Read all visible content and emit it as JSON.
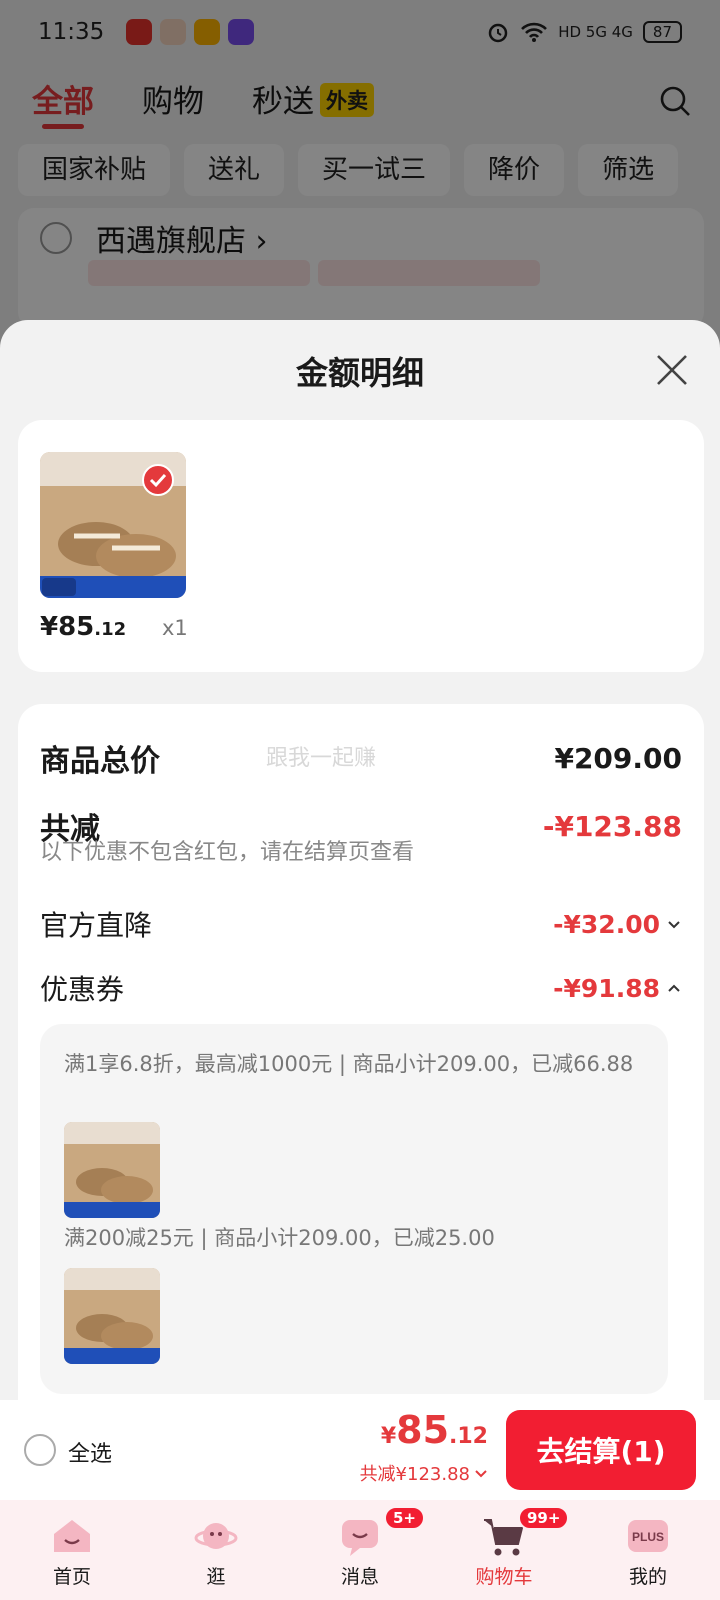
{
  "status_bar": {
    "time": "11:35",
    "network": "HD 5G 4G",
    "battery": "87"
  },
  "top_tabs": [
    {
      "label": "全部",
      "active": true
    },
    {
      "label": "购物",
      "active": false
    },
    {
      "label": "秒送",
      "active": false,
      "badge": "外卖"
    }
  ],
  "filter_chips": [
    "国家补贴",
    "送礼",
    "买一试三",
    "降价",
    "筛选"
  ],
  "shop": {
    "name": "西遇旗舰店 ›"
  },
  "sheet": {
    "title": "金额明细",
    "product": {
      "price_int": "¥85",
      "price_dec": ".12",
      "qty": "x1"
    },
    "watermark": "跟我一起赚",
    "total_label": "商品总价",
    "total_value": "¥209.00",
    "discount_label": "共减",
    "discount_value": "-¥123.88",
    "discount_note": "以下优惠不包含红包，请在结算页查看",
    "official_label": "官方直降",
    "official_value": "-¥32.00",
    "coupon_label": "优惠券",
    "coupon_value": "-¥91.88",
    "coupons": [
      {
        "text": "满1享6.8折，最高减1000元 | 商品小计209.00，已减66.88"
      },
      {
        "text": "满200减25元 | 商品小计209.00，已减25.00"
      }
    ]
  },
  "checkout": {
    "select_all": "全选",
    "currency": "¥",
    "total_int": "85",
    "total_dec": ".12",
    "saved": "共减¥123.88",
    "pay_button": "去结算(1)"
  },
  "tabbar": [
    {
      "label": "首页",
      "icon": "home-icon"
    },
    {
      "label": "逛",
      "icon": "browse-icon"
    },
    {
      "label": "消息",
      "icon": "message-icon",
      "badge": "5+"
    },
    {
      "label": "购物车",
      "icon": "cart-icon",
      "badge": "99+",
      "active": true
    },
    {
      "label": "我的",
      "icon": "plus-icon",
      "icon_text": "PLUS"
    }
  ],
  "colors": {
    "accent": "#e4393c",
    "pay_button": "#f21e32"
  }
}
